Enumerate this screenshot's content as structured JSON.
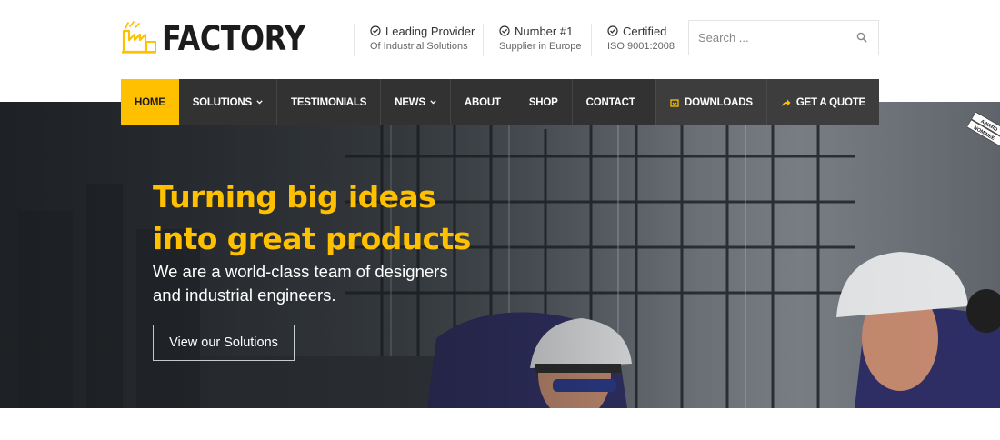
{
  "brand": {
    "name": "FACTORY"
  },
  "info": [
    {
      "title": "Leading Provider",
      "subtitle": "Of Industrial Solutions"
    },
    {
      "title": "Number #1",
      "subtitle": "Supplier in Europe"
    },
    {
      "title": "Certified",
      "subtitle": "ISO 9001:2008"
    }
  ],
  "search": {
    "placeholder": "Search ..."
  },
  "nav": {
    "items": [
      {
        "label": "HOME",
        "active": true
      },
      {
        "label": "SOLUTIONS",
        "dropdown": true
      },
      {
        "label": "TESTIMONIALS"
      },
      {
        "label": "NEWS",
        "dropdown": true
      },
      {
        "label": "ABOUT"
      },
      {
        "label": "SHOP"
      },
      {
        "label": "CONTACT"
      }
    ],
    "downloads_label": "DOWNLOADS",
    "quote_label": "GET A QUOTE"
  },
  "hero": {
    "title_line1": "Turning big ideas",
    "title_line2": "into great products",
    "subtitle_line1": "We are a world-class team of designers",
    "subtitle_line2": "and industrial engineers.",
    "button_label": "View our Solutions"
  },
  "badge": {
    "line1": "AWARD",
    "line2": "NOMINEE"
  },
  "colors": {
    "accent": "#ffc000",
    "nav_bg": "#323232",
    "text_dark": "#1c1c1c"
  }
}
